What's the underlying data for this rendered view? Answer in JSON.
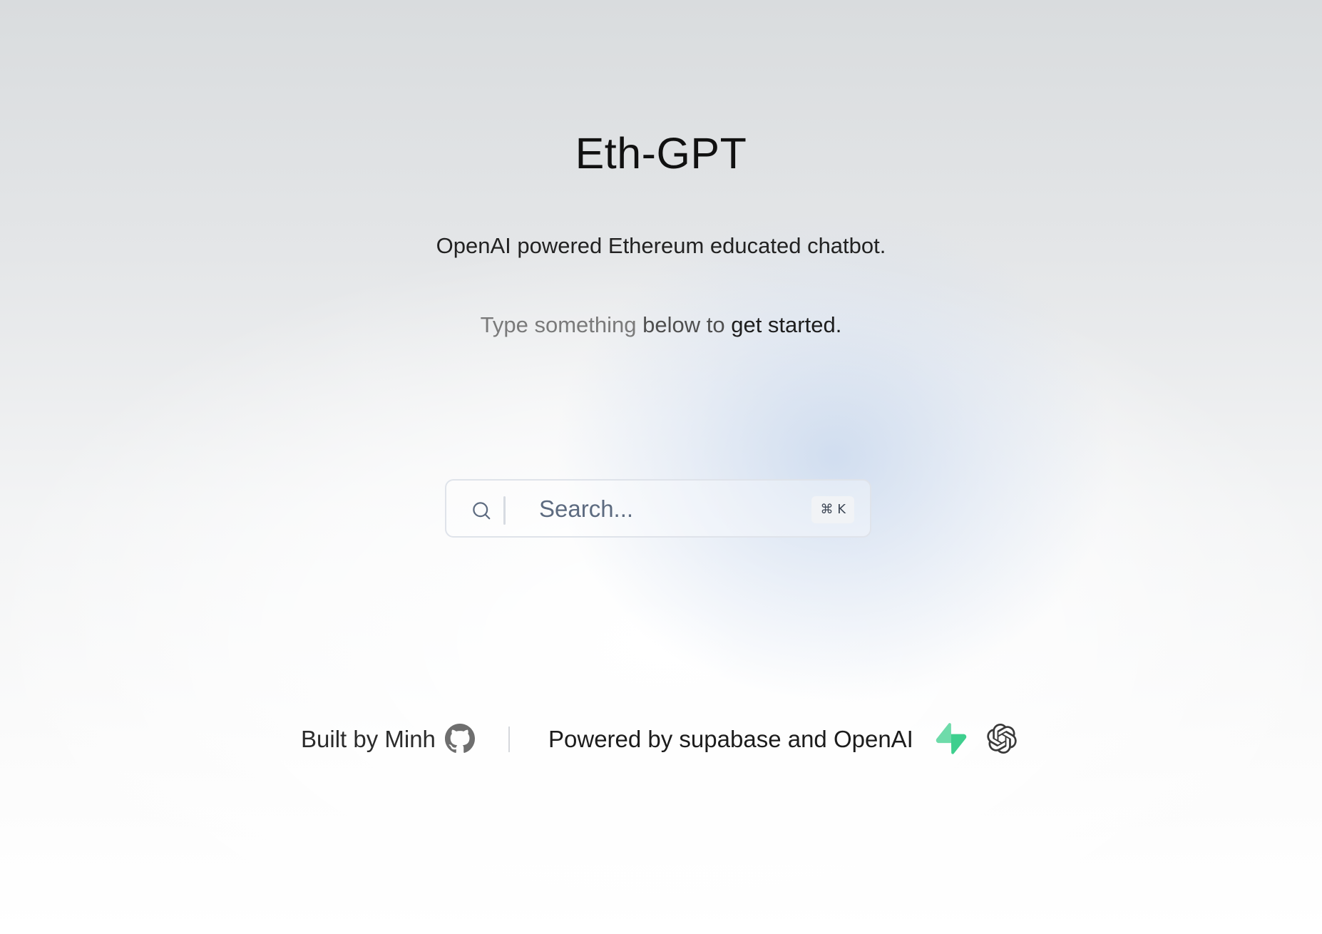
{
  "header": {
    "title": "Eth-GPT",
    "subtitle": "OpenAI powered Ethereum educated chatbot.",
    "hint_parts": [
      "Type something",
      " below to",
      " get started."
    ]
  },
  "search": {
    "placeholder": "Search...",
    "shortcut": "⌘ K",
    "icon": "search-icon"
  },
  "footer": {
    "built_by": "Built by Minh",
    "github_icon": "github-icon",
    "powered_by": "Powered by supabase and OpenAI",
    "supabase_icon": "supabase-icon",
    "openai_icon": "openai-icon"
  },
  "colors": {
    "supabase_green": "#3ecf8e",
    "search_text": "#5d6b80",
    "border": "#dfe3ea"
  }
}
